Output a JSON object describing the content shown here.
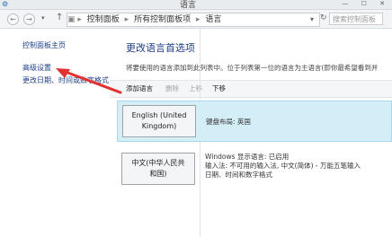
{
  "window": {
    "title": "语言"
  },
  "address": {
    "crumbs": [
      "控制面板",
      "所有控制面板项",
      "语言"
    ],
    "search_placeholder": "搜索控制面板"
  },
  "leftnav": {
    "items": [
      "控制面板主页",
      "高级设置",
      "更改日期、时间或数字格式"
    ]
  },
  "main": {
    "heading": "更改语言首选项",
    "description": "将要使用的语言添加到此列表中。位于列表第一位的语言为主语言(即你最希望看到并",
    "toolbar": {
      "add": "添加语言",
      "delete": "删除",
      "up": "上移",
      "down": "下移"
    },
    "languages": [
      {
        "name_line1": "English (United",
        "name_line2": "Kingdom)",
        "info1": "键盘布局: 英国",
        "selected": true
      },
      {
        "name_line1": "中文(中华人民共",
        "name_line2": "和国)",
        "info1": "Windows 显示语言: 已启用",
        "info2": "输入法: 不可用的输入法, 中文(简体) - 万能五笔输入",
        "info3": "日期、时间和数字格式",
        "selected": false
      }
    ]
  },
  "colors": {
    "link": "#1e3f86",
    "selected_row": "#d4eef8",
    "arrow": "#e23131"
  }
}
